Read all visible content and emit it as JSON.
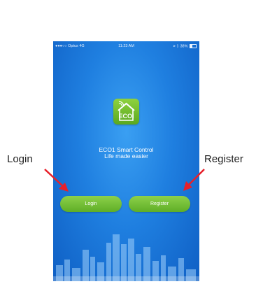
{
  "status_bar": {
    "carrier": "●●●○○ Optus  4G",
    "time": "11:23 AM",
    "battery": "38%"
  },
  "app": {
    "logo_text": "ECOI",
    "title": "ECO1 Smart Control",
    "subtitle": "Life made easier"
  },
  "buttons": {
    "login_label": "Login",
    "register_label": "Register"
  },
  "annotations": {
    "login": "Login",
    "register": "Register"
  },
  "colors": {
    "background_blue": "#1f7fe0",
    "button_green": "#6bbf2f",
    "arrow_red": "#e8202a"
  },
  "icons": [
    "house-wifi-logo-icon",
    "battery-icon",
    "location-icon",
    "bluetooth-icon"
  ]
}
